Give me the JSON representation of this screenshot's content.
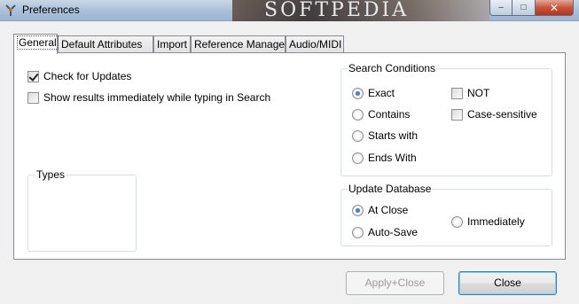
{
  "window": {
    "title": "Preferences",
    "watermark": "SOFTPEDIA",
    "caption_buttons": {
      "minimize": "–",
      "maximize": "□",
      "close": "✕"
    }
  },
  "tabs": [
    {
      "label": "General",
      "active": true
    },
    {
      "label": "Default Attributes",
      "active": false
    },
    {
      "label": "Import",
      "active": false
    },
    {
      "label": "Reference Manager",
      "active": false
    },
    {
      "label": "Audio/MIDI",
      "active": false
    }
  ],
  "general": {
    "check_for_updates": {
      "label": "Check for Updates",
      "checked": true
    },
    "show_results": {
      "label": "Show results immediately while typing in Search",
      "checked": false
    },
    "types_label": "Types"
  },
  "search_conditions": {
    "title": "Search Conditions",
    "options": [
      {
        "label": "Exact",
        "selected": true
      },
      {
        "label": "Contains",
        "selected": false
      },
      {
        "label": "Starts with",
        "selected": false
      },
      {
        "label": "Ends With",
        "selected": false
      }
    ],
    "not": {
      "label": "NOT",
      "checked": false
    },
    "case_sensitive": {
      "label": "Case-sensitive",
      "checked": false
    }
  },
  "update_database": {
    "title": "Update Database",
    "options": [
      {
        "label": "At Close",
        "selected": true
      },
      {
        "label": "Auto-Save",
        "selected": false
      },
      {
        "label": "Immediately",
        "selected": false
      }
    ]
  },
  "buttons": {
    "apply_close": "Apply+Close",
    "close": "Close"
  }
}
